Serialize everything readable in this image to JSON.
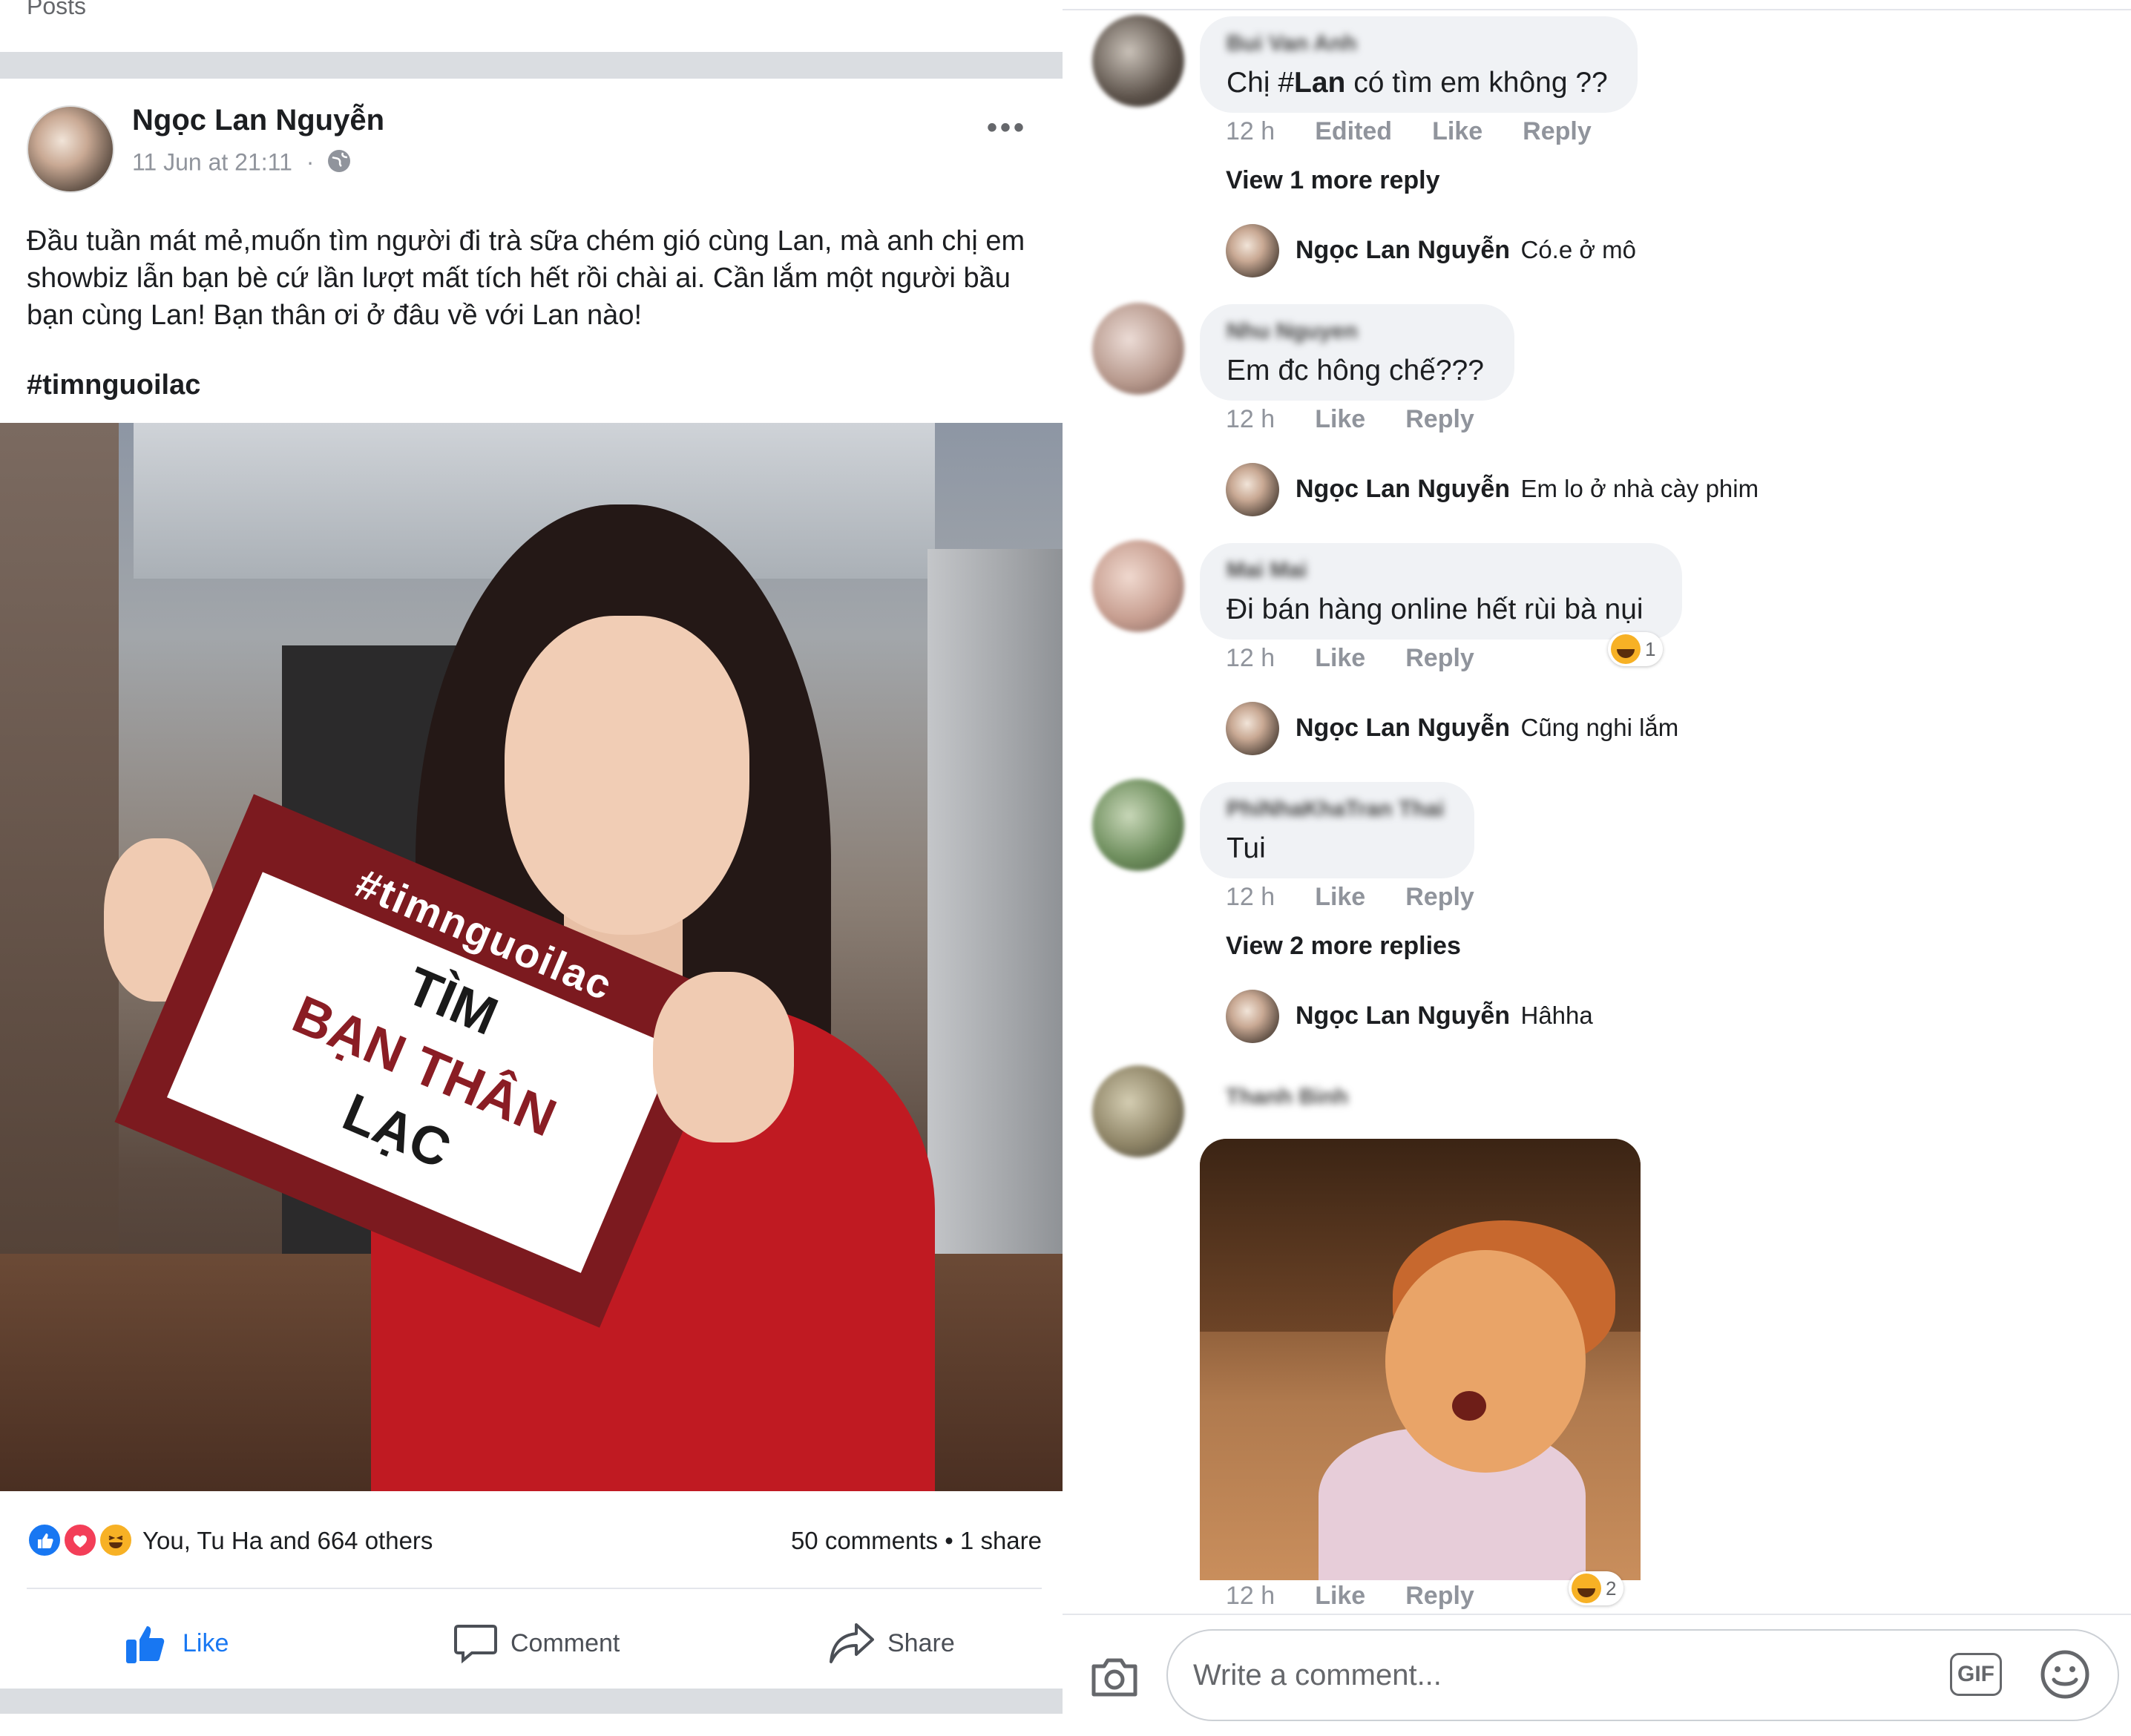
{
  "post": {
    "section_label": "Posts",
    "author": "Ngọc Lan Nguyễn",
    "timestamp": "11 Jun at 21:11",
    "separator": "·",
    "text": "Đầu tuần mát mẻ,muốn tìm người đi trà sữa chém gió cùng Lan, mà anh chị em showbiz lẫn bạn bè cứ lần lượt mất tích hết rồi chài ai. Cần lắm một người bầu bạn cùng Lan! Bạn thân ơi ở đâu về với Lan nào!",
    "hashtag": "#timnguoilac",
    "photo_sign": {
      "tag": "#timnguoilac",
      "line1": "TÌM",
      "line2": "BẠN THÂN",
      "line3": "LẠC"
    },
    "reactions_text": "You, Tu Ha and 664 others",
    "counts_text": "50 comments • 1 share",
    "actions": {
      "like": "Like",
      "comment": "Comment",
      "share": "Share"
    }
  },
  "comments": [
    {
      "text_prefix": "Chị #",
      "text_bold": "Lan",
      "text_suffix": " có tìm em không ??",
      "name": "Bui Van Anh",
      "time": "12 h",
      "edited": "Edited",
      "like": "Like",
      "reply": "Reply",
      "view_more": "View 1 more reply",
      "reply_author": "Ngọc Lan Nguyễn",
      "reply_text": "Có.e ở mô"
    },
    {
      "text": "Em đc hông chế???",
      "name": "Nhu Nguyen",
      "time": "12 h",
      "like": "Like",
      "reply": "Reply",
      "reply_author": "Ngọc Lan Nguyễn",
      "reply_text": "Em lo ở nhà cày phim"
    },
    {
      "text": "Đi bán hàng online hết rùi bà nụi",
      "name": "Mai Mai",
      "time": "12 h",
      "like": "Like",
      "reply": "Reply",
      "reaction_count": "1",
      "reply_author": "Ngọc Lan Nguyễn",
      "reply_text": "Cũng nghi lắm"
    },
    {
      "text": "Tui",
      "name": "PhiNhaKhaTran Thai",
      "time": "12 h",
      "like": "Like",
      "reply": "Reply",
      "view_more": "View 2 more replies",
      "reply_author": "Ngọc Lan Nguyễn",
      "reply_text": "Hâhha"
    },
    {
      "name": "Thanh Binh",
      "time": "12 h",
      "like": "Like",
      "reply": "Reply",
      "reaction_count": "2"
    }
  ],
  "composer": {
    "placeholder": "Write a comment...",
    "gif_label": "GIF"
  },
  "colors": {
    "accent": "#1877f2",
    "bubble": "#f0f2f5",
    "meta": "#90949c",
    "sign": "#7c1a1f"
  },
  "icons": [
    "globe-icon",
    "more-options-icon",
    "like-reaction-icon",
    "love-reaction-icon",
    "haha-reaction-icon",
    "thumbs-up-icon",
    "comment-icon",
    "share-icon",
    "camera-icon",
    "gif-icon",
    "emoji-icon"
  ]
}
